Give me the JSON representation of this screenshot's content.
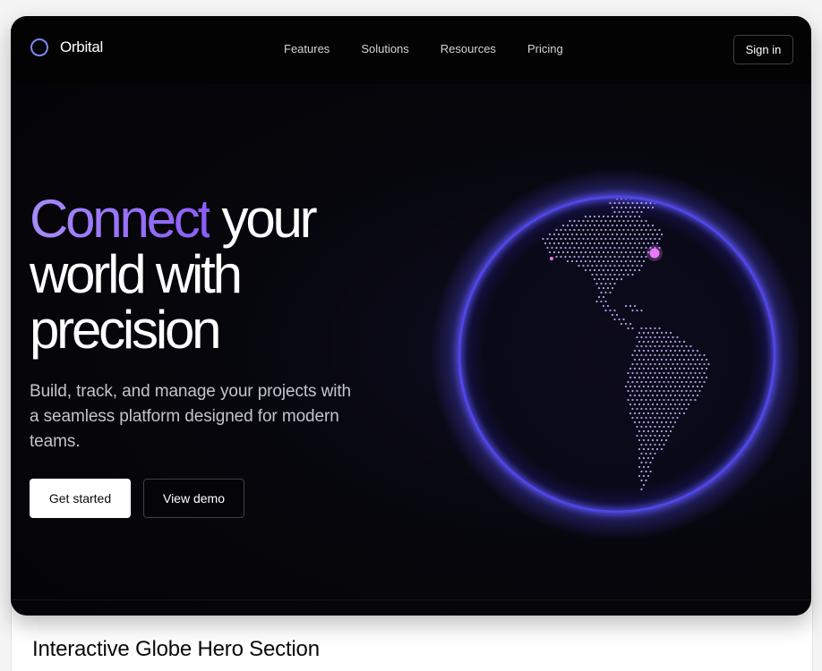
{
  "nav": {
    "brand": "Orbital",
    "links": [
      "Features",
      "Solutions",
      "Resources",
      "Pricing"
    ],
    "signin_label": "Sign in"
  },
  "hero": {
    "headline_accent": "Connect",
    "headline_rest_line1": " your",
    "headline_line2": "world with",
    "headline_line3": "precision",
    "subtitle": "Build, track, and manage your projects with a seamless platform designed for modern teams.",
    "primary_cta": "Get started",
    "secondary_cta": "View demo"
  },
  "caption": "Interactive Globe Hero Section",
  "colors": {
    "accent": "#8b5cf6",
    "globe_rim": "#4f46e5",
    "globe_dots": "#c4b5fd",
    "marker": "#e879f9",
    "background": "#050508"
  }
}
